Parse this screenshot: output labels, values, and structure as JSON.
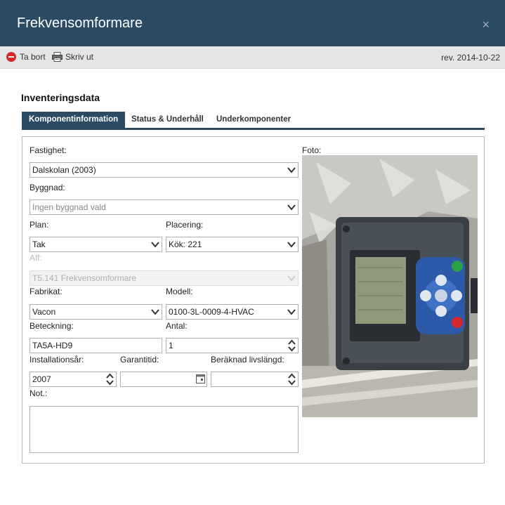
{
  "window": {
    "title": "Frekvensomformare",
    "close_label": "×"
  },
  "toolbar": {
    "delete_label": "Ta bort",
    "print_label": "Skriv ut",
    "revision": "rev. 2014-10-22"
  },
  "section_title": "Inventeringsdata",
  "tabs": [
    {
      "label": "Komponentinformation",
      "active": true
    },
    {
      "label": "Status & Underhåll",
      "active": false
    },
    {
      "label": "Underkomponenter",
      "active": false
    }
  ],
  "form": {
    "fastighet": {
      "label": "Fastighet:",
      "value": "Dalskolan (2003)"
    },
    "byggnad": {
      "label": "Byggnad:",
      "placeholder": "Ingen byggnad vald"
    },
    "plan": {
      "label": "Plan:",
      "value": "Tak"
    },
    "placering": {
      "label": "Placering:",
      "value": "Kök: 221"
    },
    "aff": {
      "label": "Aff:",
      "value": "T5.141 Frekvensomformare"
    },
    "fabrikat": {
      "label": "Fabrikat:",
      "value": "Vacon"
    },
    "modell": {
      "label": "Modell:",
      "value": "0100-3L-0009-4-HVAC"
    },
    "beteckning": {
      "label": "Beteckning:",
      "value": "TA5A-HD9"
    },
    "antal": {
      "label": "Antal:",
      "value": "1"
    },
    "installationsar": {
      "label": "Installationsår:",
      "value": "2007"
    },
    "garantitid": {
      "label": "Garantitid:",
      "value": ""
    },
    "livslangd": {
      "label": "Beräknad livslängd:",
      "value": ""
    },
    "not": {
      "label": "Not.:",
      "value": ""
    }
  },
  "photo": {
    "label": "Foto:"
  },
  "colors": {
    "header": "#2b4a63",
    "toolbar": "#e4e5e7",
    "delete_icon": "#d9272e"
  },
  "icons": {
    "delete": "minus-circle-icon",
    "print": "printer-icon",
    "close": "close-icon",
    "dropdown": "chevron-down-icon",
    "spinner": "spinner-arrows-icon",
    "calendar": "calendar-icon"
  }
}
